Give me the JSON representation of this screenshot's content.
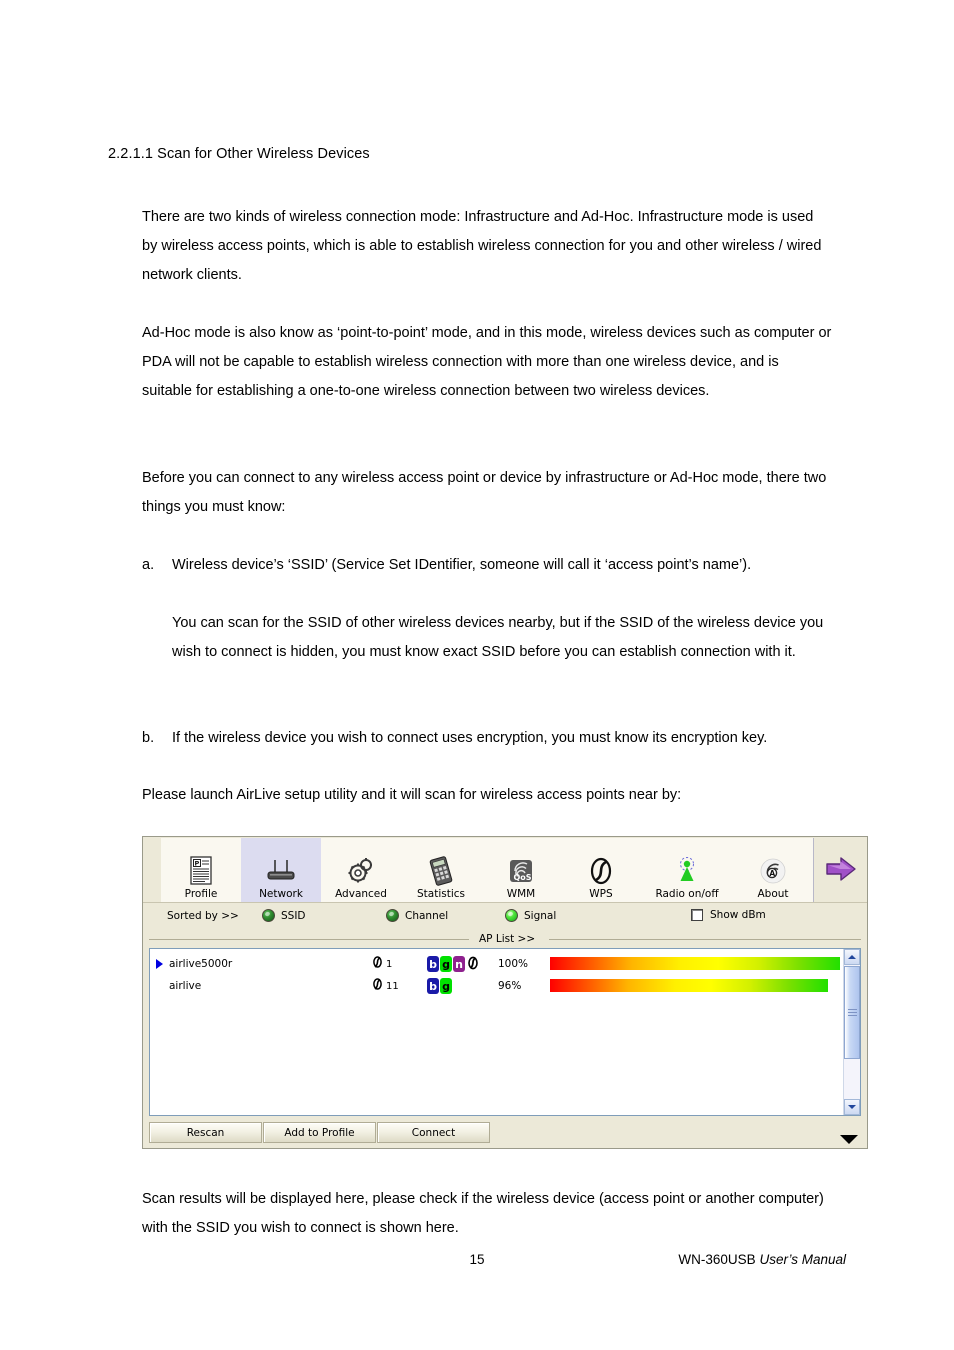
{
  "document": {
    "heading": "2.2.1.1 Scan for Other Wireless Devices",
    "paragraph_1": "There are two kinds of wireless connection mode: Infrastructure and Ad-Hoc. Infrastructure mode is used by wireless access points, which is able to establish wireless connection for you and other wireless / wired network clients.",
    "paragraph_2": "Ad-Hoc mode is also know as ‘point-to-point’ mode, and in this mode, wireless devices such as computer or PDA will not be capable to establish wireless connection with more than one wireless device, and is suitable for establishing a one-to-one wireless connection between two wireless devices.",
    "paragraph_3": "Before you can connect to any wireless access point or device by infrastructure or Ad-Hoc mode, there two things you must know:",
    "item_a_marker": "a.",
    "item_a_text": "Wireless device’s ‘SSID’ (Service Set IDentifier, someone will call it ‘access point’s name’).",
    "item_a_detail": "You can scan for the SSID of other wireless devices nearby, but if the SSID of the wireless device you wish to connect is hidden, you must know exact SSID before you can establish connection with it.",
    "item_b_marker": "b.",
    "item_b_text": "If the wireless device you wish to connect uses encryption, you must know its encryption key.",
    "paragraph_4": "Please launch AirLive setup utility and it will scan for wireless access points near by:",
    "paragraph_5": "Scan results will be displayed here, please check if the wireless device (access point or another computer) with the SSID you wish to connect is shown here.",
    "footer_page_number": "15",
    "footer_product": "WN-360USB",
    "footer_manual": "User’s Manual"
  },
  "app": {
    "toolbar": {
      "items": [
        {
          "label": "Profile",
          "icon": "profile-document-icon",
          "selected": false
        },
        {
          "label": "Network",
          "icon": "router-icon",
          "selected": true
        },
        {
          "label": "Advanced",
          "icon": "gears-icon",
          "selected": false
        },
        {
          "label": "Statistics",
          "icon": "calculator-icon",
          "selected": false
        },
        {
          "label": "WMM",
          "icon": "qos-signal-icon",
          "selected": false
        },
        {
          "label": "WPS",
          "icon": "wps-swirl-icon",
          "selected": false
        },
        {
          "label": "Radio on/off",
          "icon": "radio-antenna-icon",
          "selected": false
        },
        {
          "label": "About",
          "icon": "about-signal-icon",
          "selected": false
        }
      ],
      "next_arrow_icon": "purple-right-arrow-icon"
    },
    "sortbar": {
      "label": "Sorted by >>",
      "options": [
        {
          "label": "SSID",
          "selected": false
        },
        {
          "label": "Channel",
          "selected": false
        },
        {
          "label": "Signal",
          "selected": true
        }
      ],
      "show_dbm_label": "Show dBm",
      "show_dbm_checked": false
    },
    "aplist": {
      "group_label": "AP List >>",
      "rows": [
        {
          "selected": true,
          "ssid": "airlive5000r",
          "channel": "1",
          "modes": [
            "b",
            "g",
            "n"
          ],
          "has_wps": true,
          "signal_percent": "100%",
          "signal_value": 100
        },
        {
          "selected": false,
          "ssid": "airlive",
          "channel": "11",
          "modes": [
            "b",
            "g"
          ],
          "has_wps": false,
          "signal_percent": "96%",
          "signal_value": 96
        }
      ]
    },
    "buttons": {
      "rescan": "Rescan",
      "add_to_profile": "Add to Profile",
      "connect": "Connect"
    },
    "colors": {
      "window_face": "#ece9d8",
      "selected_tab": "#dcdcf0",
      "mode_b": "#1a1aa8",
      "mode_g": "#00e000",
      "mode_n": "#8e218e",
      "selection_marker": "#0000e0"
    }
  }
}
